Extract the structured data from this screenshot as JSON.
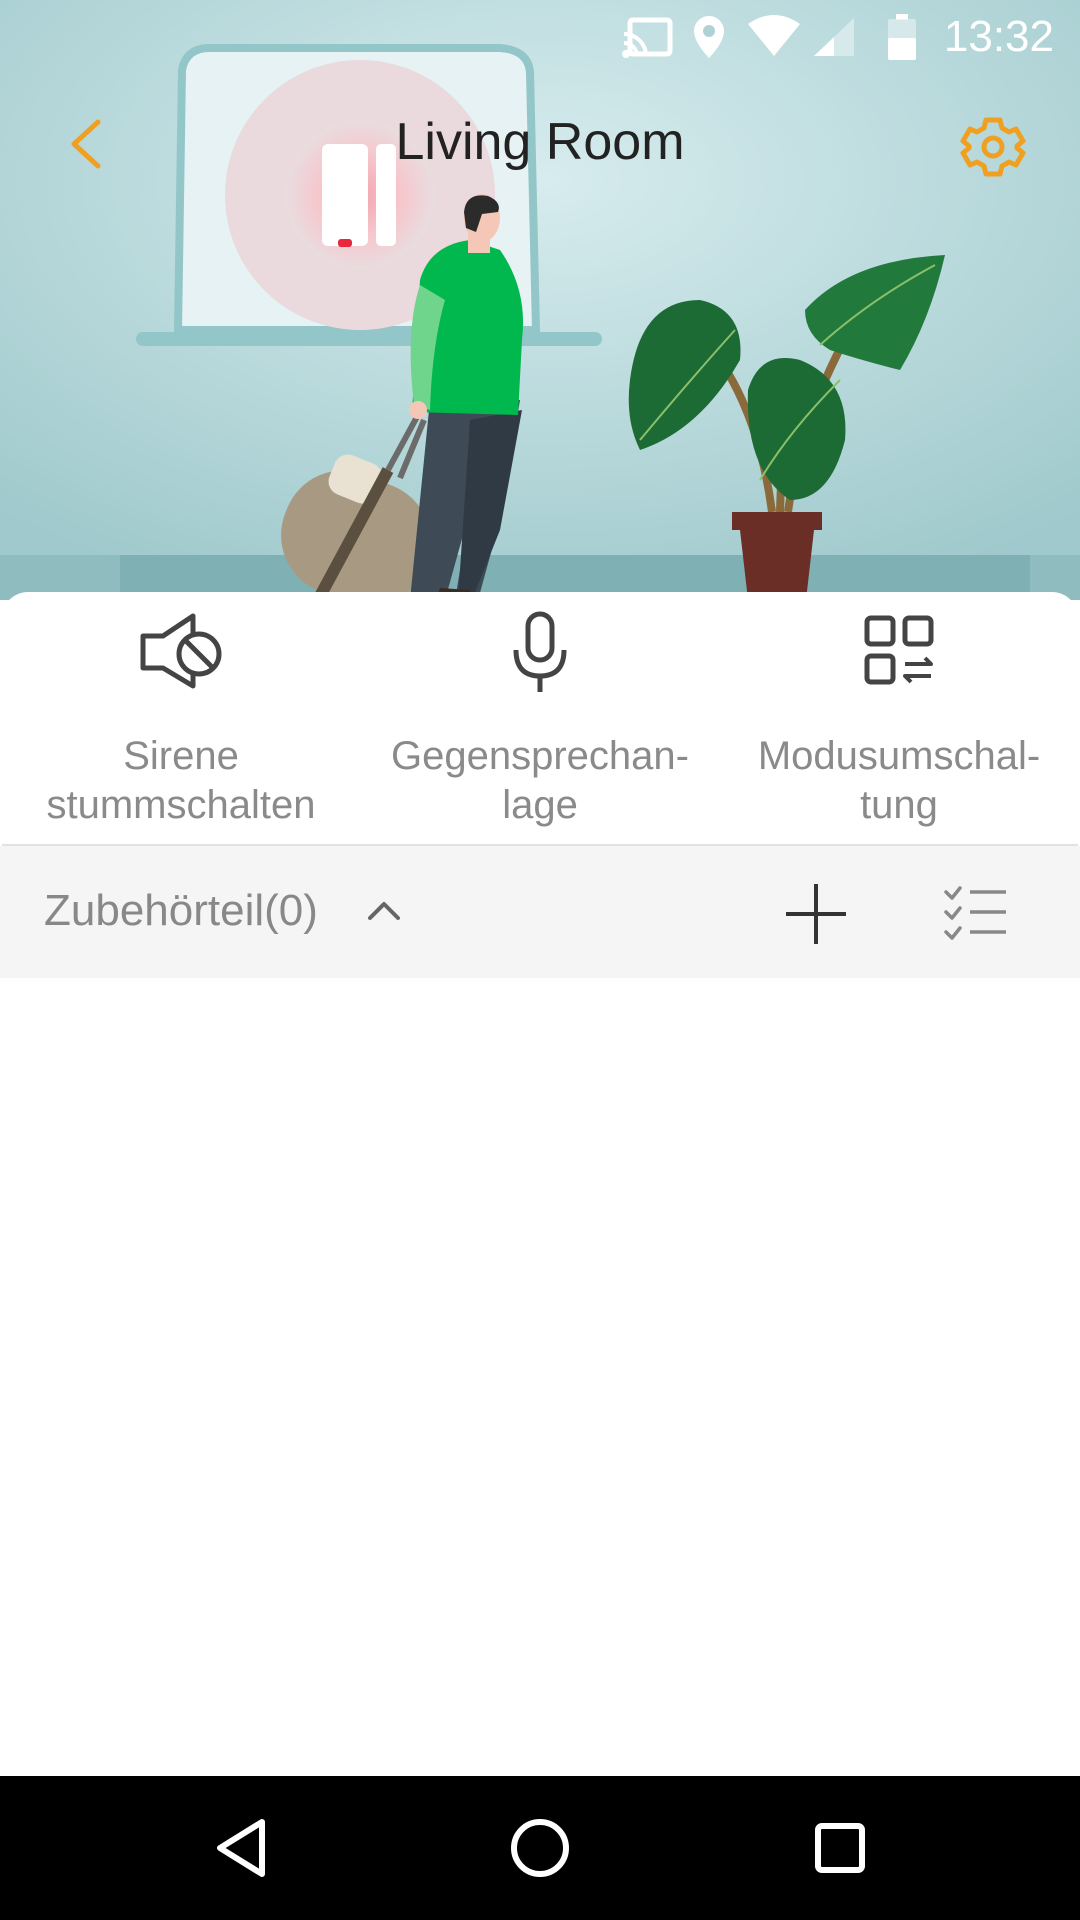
{
  "status_bar": {
    "time": "13:32",
    "icons": [
      "cast-icon",
      "location-pin-icon",
      "wifi-icon",
      "cell-signal-icon",
      "battery-icon"
    ]
  },
  "header": {
    "title": "Living Room",
    "back_icon": "chevron-left-icon",
    "settings_icon": "gear-icon",
    "accent_color": "#F0A020"
  },
  "hero": {
    "illustration": "traveler-leaving-home-illustration",
    "sensor_status_color": "#E8283C"
  },
  "actions": [
    {
      "icon": "speaker-muted-icon",
      "label": "Sirene stummschalten"
    },
    {
      "icon": "microphone-icon",
      "label": "Gegensprechan-lage"
    },
    {
      "icon": "mode-switch-icon",
      "label": "Modusumschal-tung"
    }
  ],
  "accessories": {
    "title": "Zubehörteil(0)",
    "collapse_icon": "chevron-up-icon",
    "add_icon": "plus-icon",
    "edit_list_icon": "checklist-icon"
  },
  "nav_bar": {
    "icons": [
      "back-triangle-icon",
      "home-circle-icon",
      "recents-square-icon"
    ]
  }
}
